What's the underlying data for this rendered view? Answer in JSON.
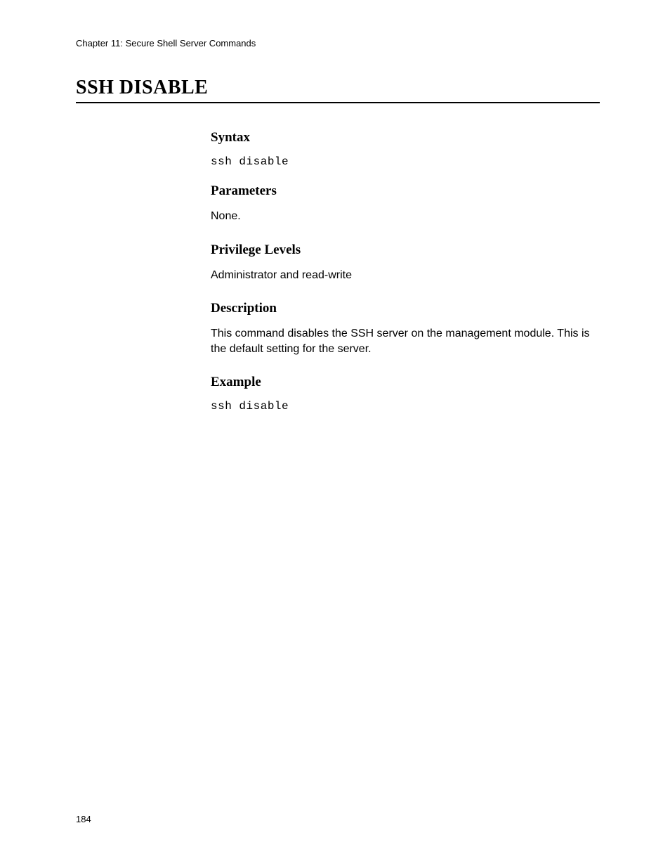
{
  "header": {
    "chapter": "Chapter 11: Secure Shell Server Commands"
  },
  "title": "SSH DISABLE",
  "sections": {
    "syntax": {
      "heading": "Syntax",
      "code": "ssh disable"
    },
    "parameters": {
      "heading": "Parameters",
      "text": "None."
    },
    "privilege": {
      "heading": "Privilege Levels",
      "text": "Administrator and read-write"
    },
    "description": {
      "heading": "Description",
      "text": "This command disables the SSH server on the management module. This is the default setting for the server."
    },
    "example": {
      "heading": "Example",
      "code": "ssh disable"
    }
  },
  "page_number": "184"
}
